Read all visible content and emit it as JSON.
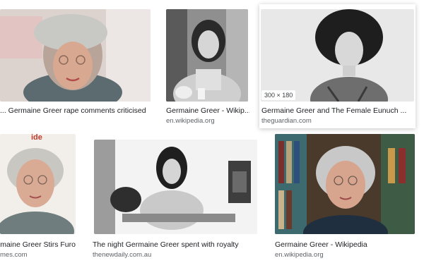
{
  "results": [
    {
      "title": "Germaine Greer rape comments criticised ...",
      "source": ""
    },
    {
      "title": "Germaine Greer - Wikip...",
      "source": "en.wikipedia.org"
    },
    {
      "title": "Germaine Greer and The Female Eunuch ...",
      "source": "theguardian.com",
      "dimensions": "300 × 180"
    },
    {
      "title": "Germaine Greer Stirs Furo...",
      "source": "mes.com"
    },
    {
      "title": "The night Germaine Greer spent with royalty",
      "source": "thenewdaily.com.au"
    },
    {
      "title": "Germaine Greer - Wikipedia",
      "source": "en.wikipedia.org"
    }
  ],
  "overlay_text": {
    "logo_fragment": "ide"
  },
  "colors": {
    "title": "#202124",
    "source": "#5f6368",
    "background": "#ffffff"
  }
}
